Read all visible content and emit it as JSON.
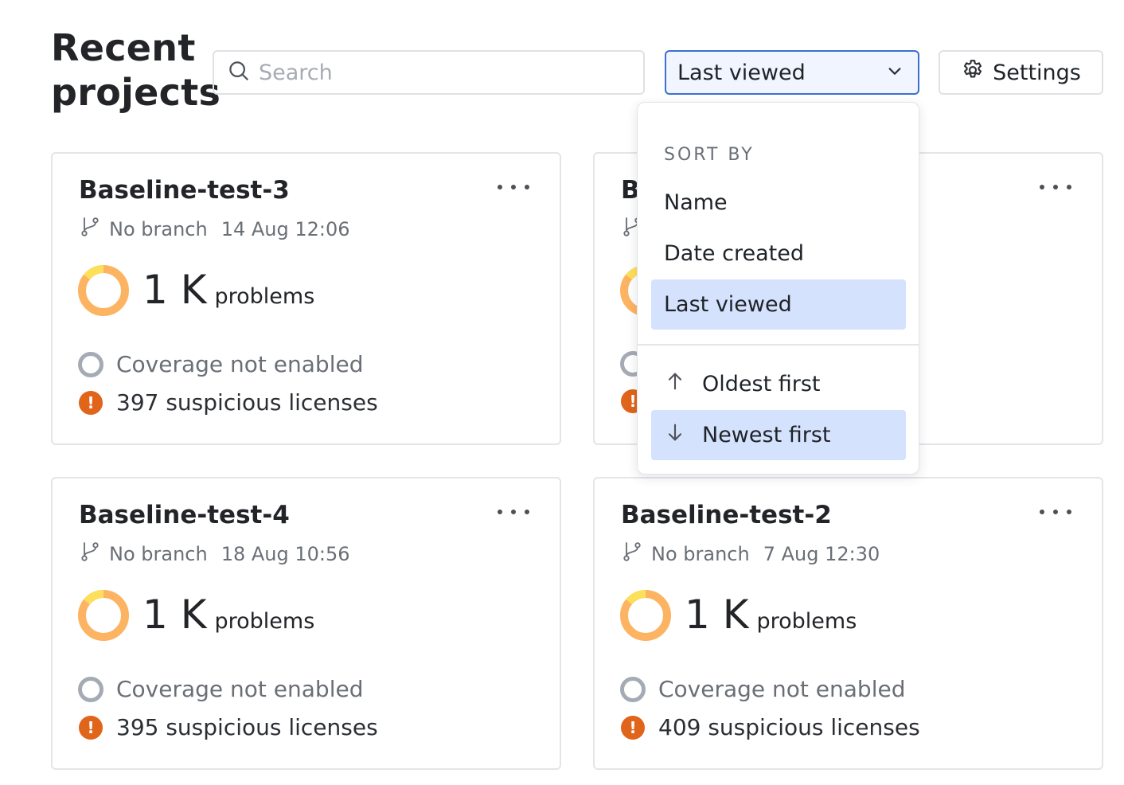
{
  "header": {
    "title": "Recent projects",
    "search_placeholder": "Search",
    "sort_selected": "Last viewed",
    "settings_label": "Settings"
  },
  "sort_menu": {
    "heading": "SORT BY",
    "options": [
      "Name",
      "Date created",
      "Last viewed"
    ],
    "selected_option": "Last viewed",
    "directions": [
      "Oldest first",
      "Newest first"
    ],
    "selected_direction": "Newest first",
    "highlight_color": "#d4e2fd"
  },
  "projects": [
    {
      "name": "Baseline-test-3",
      "branch": "No branch",
      "date": "14 Aug 12:06",
      "problems_count": "1 K",
      "problems_label": "problems",
      "coverage": "Coverage not enabled",
      "licenses": "397 suspicious licenses"
    },
    {
      "name": "B",
      "branch": "",
      "date": "",
      "problems_count": "",
      "problems_label": "",
      "coverage": "",
      "licenses": ""
    },
    {
      "name": "Baseline-test-4",
      "branch": "No branch",
      "date": "18 Aug 10:56",
      "problems_count": "1 K",
      "problems_label": "problems",
      "coverage": "Coverage not enabled",
      "licenses": "395 suspicious licenses"
    },
    {
      "name": "Baseline-test-2",
      "branch": "No branch",
      "date": "7 Aug 12:30",
      "problems_count": "1 K",
      "problems_label": "problems",
      "coverage": "Coverage not enabled",
      "licenses": "409 suspicious licenses"
    }
  ],
  "colors": {
    "accent": "#3d6fd0",
    "donut_main": "#fdb462",
    "donut_secondary": "#fde05a",
    "warning": "#e0641a"
  }
}
